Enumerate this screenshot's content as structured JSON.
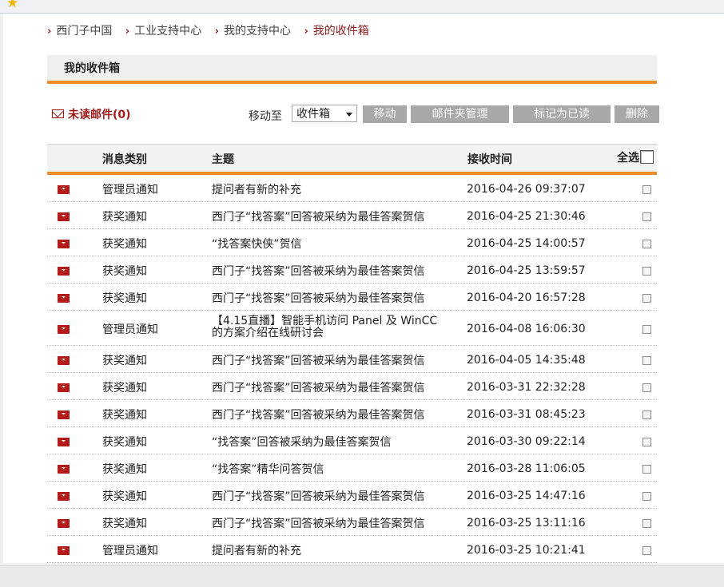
{
  "breadcrumb": {
    "items": [
      {
        "label": "西门子中国"
      },
      {
        "label": "工业支持中心"
      },
      {
        "label": "我的支持中心"
      },
      {
        "label": "我的收件箱"
      }
    ]
  },
  "section": {
    "title": "我的收件箱"
  },
  "unread": {
    "label": "未读邮件(0)"
  },
  "toolbar": {
    "move_to_label": "移动至",
    "folder_selected": "收件箱",
    "move_button": "移动",
    "folder_manage_button": "邮件夹管理",
    "mark_read_button": "标记为已读",
    "delete_button": "删除"
  },
  "table": {
    "headers": {
      "category": "消息类别",
      "subject": "主题",
      "received": "接收时间",
      "select_all": "全选"
    },
    "rows": [
      {
        "category": "管理员通知",
        "subject": "提问者有新的补充",
        "time": "2016-04-26 09:37:07"
      },
      {
        "category": "获奖通知",
        "subject": "西门子“找答案”回答被采纳为最佳答案贺信",
        "time": "2016-04-25 21:30:46"
      },
      {
        "category": "获奖通知",
        "subject": "“找答案快侠”贺信",
        "time": "2016-04-25 14:00:57"
      },
      {
        "category": "获奖通知",
        "subject": "西门子“找答案”回答被采纳为最佳答案贺信",
        "time": "2016-04-25 13:59:57"
      },
      {
        "category": "获奖通知",
        "subject": "西门子“找答案”回答被采纳为最佳答案贺信",
        "time": "2016-04-20 16:57:28"
      },
      {
        "category": "管理员通知",
        "subject": "【4.15直播】智能手机访问 Panel 及 WinCC 的方案介绍在线研讨会",
        "time": "2016-04-08 16:06:30"
      },
      {
        "category": "获奖通知",
        "subject": "西门子“找答案”回答被采纳为最佳答案贺信",
        "time": "2016-04-05 14:35:48"
      },
      {
        "category": "获奖通知",
        "subject": "西门子“找答案”回答被采纳为最佳答案贺信",
        "time": "2016-03-31 22:32:28"
      },
      {
        "category": "获奖通知",
        "subject": "西门子“找答案”回答被采纳为最佳答案贺信",
        "time": "2016-03-31 08:45:23"
      },
      {
        "category": "获奖通知",
        "subject": "“找答案”回答被采纳为最佳答案贺信",
        "time": "2016-03-30 09:22:14"
      },
      {
        "category": "获奖通知",
        "subject": "“找答案”精华问答贺信",
        "time": "2016-03-28 11:06:05"
      },
      {
        "category": "获奖通知",
        "subject": "西门子“找答案”回答被采纳为最佳答案贺信",
        "time": "2016-03-25 14:47:16"
      },
      {
        "category": "获奖通知",
        "subject": "西门子“找答案”回答被采纳为最佳答案贺信",
        "time": "2016-03-25 13:11:16"
      },
      {
        "category": "管理员通知",
        "subject": "提问者有新的补充",
        "time": "2016-03-25 10:21:41"
      }
    ]
  },
  "colors": {
    "accent_orange": "#f28c28",
    "dark_red": "#a11a1a",
    "button_gray": "#a8a8a8"
  },
  "icons": {
    "app": "star-icon",
    "message": "envelope-icon",
    "unread": "mail-outline-icon"
  }
}
